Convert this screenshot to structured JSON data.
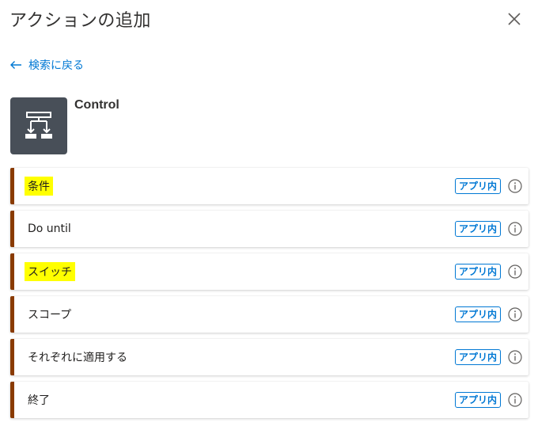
{
  "panel": {
    "title": "アクションの追加"
  },
  "back": {
    "label": "検索に戻る"
  },
  "connector": {
    "name": "Control"
  },
  "actions": [
    {
      "label": "条件",
      "badge": "アプリ内",
      "highlighted": true
    },
    {
      "label": "Do until",
      "badge": "アプリ内",
      "highlighted": false
    },
    {
      "label": "スイッチ",
      "badge": "アプリ内",
      "highlighted": true
    },
    {
      "label": "スコープ",
      "badge": "アプリ内",
      "highlighted": false
    },
    {
      "label": "それぞれに適用する",
      "badge": "アプリ内",
      "highlighted": false
    },
    {
      "label": "終了",
      "badge": "アプリ内",
      "highlighted": false
    }
  ],
  "colors": {
    "accent": "#0078d4",
    "item_border": "#8a3b00",
    "highlight": "#ffff00",
    "icon_bg": "#484f58"
  }
}
